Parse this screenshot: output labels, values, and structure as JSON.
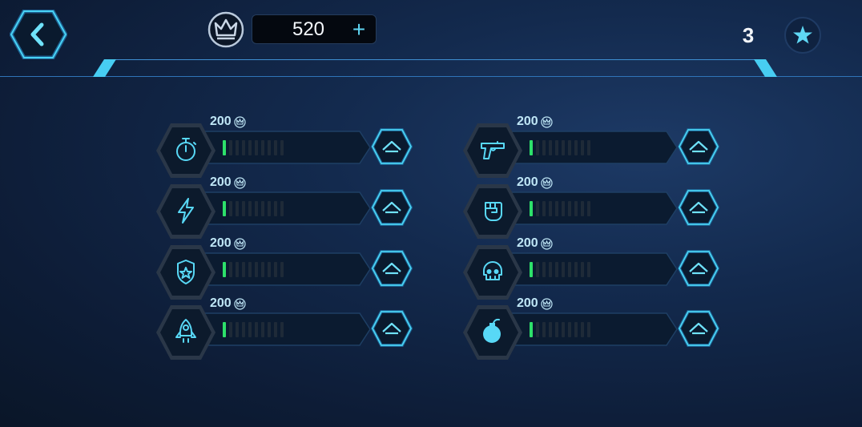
{
  "header": {
    "back_icon": "chevron-left-icon",
    "currency_icon": "crown-icon",
    "currency_value": "520",
    "add_label": "+",
    "stars_count": "3",
    "star_icon": "star-icon"
  },
  "colors": {
    "accent": "#41c7ee",
    "progress_on": "#2de06a",
    "progress_off": "#1e2a38"
  },
  "upgrades": [
    {
      "icon": "stopwatch-icon",
      "cost": "200",
      "level": 1,
      "max_level": 10
    },
    {
      "icon": "pistol-icon",
      "cost": "200",
      "level": 1,
      "max_level": 10
    },
    {
      "icon": "lightning-icon",
      "cost": "200",
      "level": 1,
      "max_level": 10
    },
    {
      "icon": "fist-icon",
      "cost": "200",
      "level": 1,
      "max_level": 10
    },
    {
      "icon": "shield-star-icon",
      "cost": "200",
      "level": 1,
      "max_level": 10
    },
    {
      "icon": "skull-icon",
      "cost": "200",
      "level": 1,
      "max_level": 10
    },
    {
      "icon": "rocket-icon",
      "cost": "200",
      "level": 1,
      "max_level": 10
    },
    {
      "icon": "bomb-icon",
      "cost": "200",
      "level": 1,
      "max_level": 10
    }
  ]
}
